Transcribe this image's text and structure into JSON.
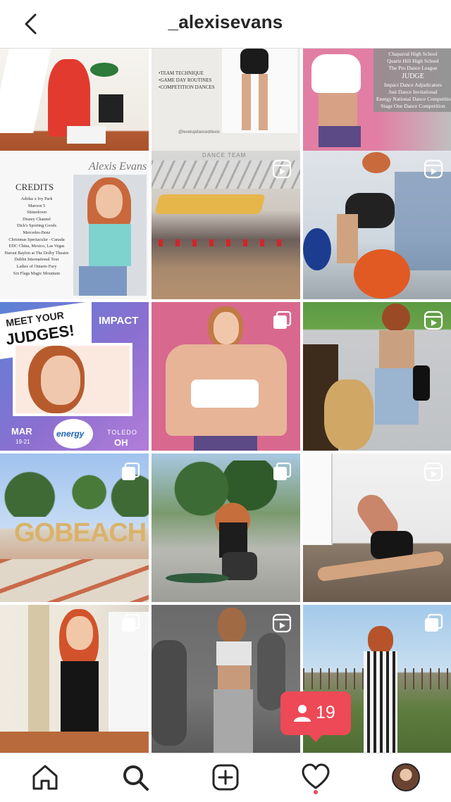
{
  "header": {
    "username": "_alexisevans"
  },
  "tiles": {
    "t3": {
      "lines": [
        "•TEAM TECHNIQUE",
        "•GAME DAY ROUTINES",
        "•COMPETITION DANCES"
      ],
      "handle": "@levelupdancedrlexis"
    },
    "t4": {
      "schools": [
        "Chaparral High School",
        "Quartz Hill High School",
        "The Pro Dance League"
      ],
      "heading": "JUDGE",
      "events": [
        "Impact Dance Adjudicators",
        "Just Dance Invitational",
        "Energy National Dance Competition",
        "Stage One Dance Competition"
      ]
    },
    "t5": {
      "name": "Alexis Evans",
      "heading": "CREDITS",
      "credits": [
        "Adidas x Ivy Park",
        "Maroon 5",
        "Shinedown",
        "Disney Channel",
        "Dick's Sporting Goods",
        "Mercedes-Benz",
        "Christmas Spectacular - Canada",
        "EDC China, Mexico, Las Vegas",
        "Harout Baylon at The Dolby Theatre",
        "Dublin International Tour",
        "Ladies of Ontario Fury",
        "Six Flags Magic Mountain"
      ]
    },
    "t6": {
      "top_text": "DANCE TEAM"
    },
    "t7": {
      "line1": "MEET YOUR",
      "line2": "JUDGES!",
      "brand": "IMPACT",
      "month": "MAR",
      "dates": "19-21",
      "logo": "energy",
      "city": "TOLEDO",
      "state": "OH"
    },
    "t10": {
      "sign": "GOBEACH"
    }
  },
  "notification": {
    "count": "19",
    "icon": "person-icon"
  },
  "nav": [
    "home-icon",
    "search-icon",
    "add-post-icon",
    "activity-heart-icon",
    "profile-avatar"
  ],
  "colors": {
    "accent": "#ed4956",
    "text": "#262626"
  }
}
